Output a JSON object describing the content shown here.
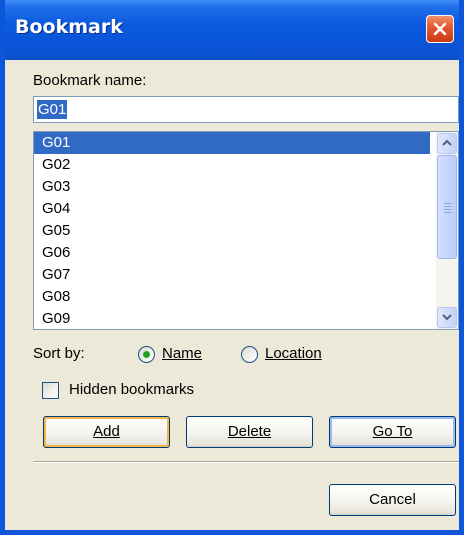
{
  "window": {
    "title": "Bookmark"
  },
  "form": {
    "name_label": "Bookmark name:",
    "name_value": "G01"
  },
  "bookmarks": {
    "items": [
      "G01",
      "G02",
      "G03",
      "G04",
      "G05",
      "G06",
      "G07",
      "G08",
      "G09"
    ],
    "selected": "G01"
  },
  "sort": {
    "label": "Sort by:",
    "name_option": "Name",
    "location_option": "Location",
    "selected": "Name"
  },
  "hidden": {
    "label": "Hidden bookmarks",
    "checked": false
  },
  "buttons": {
    "add": "Add",
    "delete": "Delete",
    "goto": "Go To",
    "cancel": "Cancel"
  },
  "colors": {
    "titlebar": "#0a55d8",
    "selection": "#316ac5",
    "dialog_bg": "#ece9d8",
    "close_button": "#e2572d",
    "radio_dot": "#21a121"
  },
  "icons": [
    "close-icon",
    "scroll-up-arrow-icon",
    "scroll-down-arrow-icon"
  ]
}
